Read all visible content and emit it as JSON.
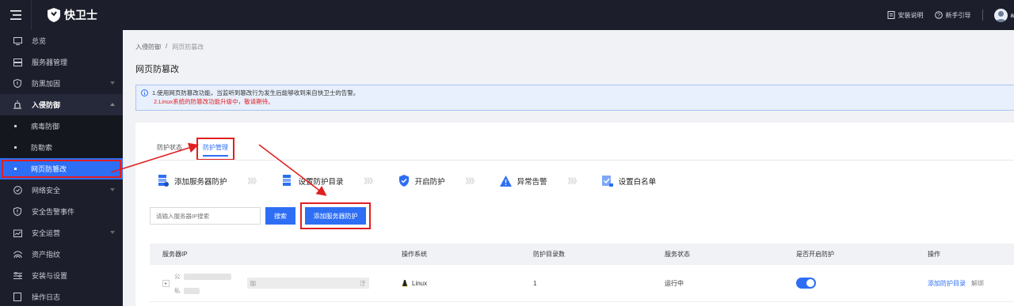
{
  "header": {
    "app_name": "快卫士",
    "install_guide": "安装说明",
    "beginner_guide": "新手引导",
    "user_initial": "a"
  },
  "sidebar": {
    "items": [
      {
        "label": "总览",
        "icon": "monitor-icon"
      },
      {
        "label": "服务器管理",
        "icon": "server-icon"
      },
      {
        "label": "防黑加固",
        "icon": "shield-icon",
        "has_children": true
      },
      {
        "label": "入侵防御",
        "icon": "alarm-icon",
        "has_children": true,
        "open": true
      },
      {
        "label": "网络安全",
        "icon": "network-icon",
        "has_children": true
      },
      {
        "label": "安全告警事件",
        "icon": "alert-icon"
      },
      {
        "label": "安全运营",
        "icon": "operations-icon",
        "has_children": true
      },
      {
        "label": "资产指纹",
        "icon": "fingerprint-icon"
      },
      {
        "label": "安装与设置",
        "icon": "settings-icon"
      },
      {
        "label": "操作日志",
        "icon": "log-icon"
      }
    ],
    "sub_items": [
      {
        "label": "病毒防御"
      },
      {
        "label": "防勒索"
      },
      {
        "label": "网页防篡改",
        "active": true
      }
    ]
  },
  "breadcrumb": {
    "parent": "入侵防御",
    "separator": "/",
    "current": "网页防篡改"
  },
  "page_title": "网页防篡改",
  "notice": {
    "line1": "1.使用网页防篡改功能，当监听到篡改行为发生后能够收到来自快卫士的告警。",
    "line2": "2.Linux系统的防篡改功能升级中，敬请期待。"
  },
  "tabs": [
    {
      "label": "防护状态",
      "active": false
    },
    {
      "label": "防护管理",
      "active": true
    }
  ],
  "steps": [
    {
      "label": "添加服务器防护",
      "icon": "server-stack-icon"
    },
    {
      "label": "设置防护目录",
      "icon": "folder-list-icon"
    },
    {
      "label": "开启防护",
      "icon": "shield-check-icon"
    },
    {
      "label": "异常告警",
      "icon": "warning-icon"
    },
    {
      "label": "设置白名单",
      "icon": "checklist-icon"
    }
  ],
  "step_arrow": "》》》",
  "search": {
    "placeholder": "请输入服务器IP搜索",
    "button": "搜索",
    "add_button": "添加服务器防护"
  },
  "table": {
    "headers": [
      "服务器IP",
      "操作系统",
      "防护目录数",
      "服务状态",
      "是否开启防护",
      "操作"
    ],
    "rows": [
      {
        "ip_public_tag": "公",
        "ip_private_tag": "私",
        "name_prefix": "珈",
        "name_suffix": "汙",
        "os": "Linux",
        "dir_count": "1",
        "status": "运行中",
        "protection_on": true,
        "op_add_dir": "添加防护目录",
        "op_unbind": "解绑"
      }
    ]
  },
  "colors": {
    "primary": "#2d6ef5",
    "sidebar_bg": "#1c1f2b",
    "annotation_red": "#e02020"
  }
}
